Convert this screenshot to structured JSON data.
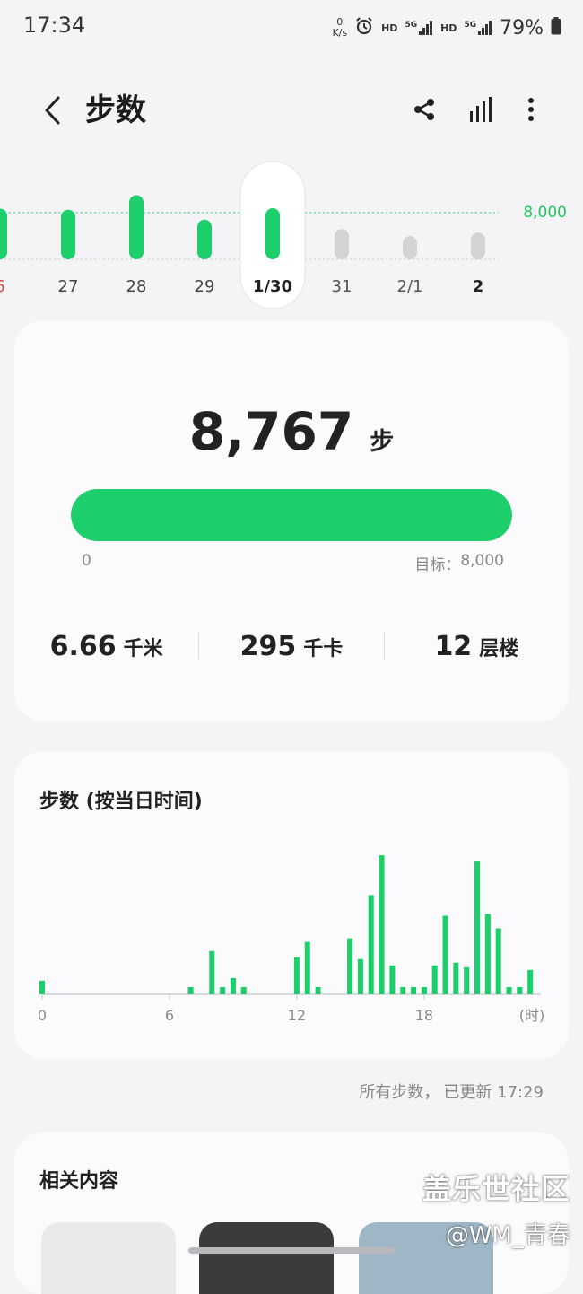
{
  "status_bar": {
    "time": "17:34",
    "net_speed_value": "0",
    "net_speed_unit": "K/s",
    "hd1": "HD",
    "sim1": "5G",
    "hd2": "HD",
    "sim2": "5G",
    "battery": "79%",
    "icons": [
      "alarm-icon",
      "signal-icon",
      "battery-icon"
    ]
  },
  "header": {
    "title": "步数",
    "icons": [
      "back-icon",
      "share-icon",
      "bar-chart-icon",
      "more-vert-icon"
    ]
  },
  "day_strip": {
    "goal_label": "8,000",
    "goal": 8000,
    "days": [
      {
        "label": "6",
        "steps": 8700,
        "color": "#1ccf6a",
        "label_color": "#e23b3b",
        "selected": false,
        "bold": false
      },
      {
        "label": "27",
        "steps": 8500,
        "color": "#1ccf6a",
        "label_color": "#444444",
        "selected": false,
        "bold": false
      },
      {
        "label": "28",
        "steps": 11000,
        "color": "#1ccf6a",
        "label_color": "#444444",
        "selected": false,
        "bold": false
      },
      {
        "label": "29",
        "steps": 6800,
        "color": "#1ccf6a",
        "label_color": "#444444",
        "selected": false,
        "bold": false
      },
      {
        "label": "1/30",
        "steps": 8767,
        "color": "#1ccf6a",
        "label_color": "#222222",
        "selected": true,
        "bold": true
      },
      {
        "label": "31",
        "steps": 5200,
        "color": "#d3d3d6",
        "label_color": "#555555",
        "selected": false,
        "bold": false
      },
      {
        "label": "2/1",
        "steps": 4000,
        "color": "#d3d3d6",
        "label_color": "#555555",
        "selected": false,
        "bold": false
      },
      {
        "label": "2",
        "steps": 4600,
        "color": "#d3d3d6",
        "label_color": "#222222",
        "selected": false,
        "bold": true
      }
    ]
  },
  "summary": {
    "steps": "8,767",
    "steps_unit": "步",
    "progress": 1.0,
    "progress_min": "0",
    "goal_prefix": "目标：",
    "goal_value": "8,000",
    "distance": "6.66",
    "distance_unit": "千米",
    "calories": "295",
    "calories_unit": "千卡",
    "floors": "12",
    "floors_unit": "层楼"
  },
  "hourly": {
    "title": "步数 (按当日时间)",
    "unit_label": "(时)"
  },
  "chart_data": {
    "type": "bar",
    "title": "步数 (按当日时间)",
    "xlabel": "(时)",
    "ylabel": "",
    "x_ticks": [
      "0",
      "6",
      "12",
      "18"
    ],
    "xlim": [
      0,
      23.5
    ],
    "ylim": [
      0,
      1700
    ],
    "bars": [
      {
        "x": 0,
        "y": 150
      },
      {
        "x": 7,
        "y": 80
      },
      {
        "x": 8,
        "y": 480
      },
      {
        "x": 8.5,
        "y": 80
      },
      {
        "x": 9,
        "y": 180
      },
      {
        "x": 9.5,
        "y": 80
      },
      {
        "x": 12,
        "y": 410
      },
      {
        "x": 12.5,
        "y": 580
      },
      {
        "x": 13,
        "y": 80
      },
      {
        "x": 14.5,
        "y": 620
      },
      {
        "x": 15,
        "y": 390
      },
      {
        "x": 15.5,
        "y": 1100
      },
      {
        "x": 16,
        "y": 1540
      },
      {
        "x": 16.5,
        "y": 320
      },
      {
        "x": 17,
        "y": 80
      },
      {
        "x": 17.5,
        "y": 80
      },
      {
        "x": 18,
        "y": 80
      },
      {
        "x": 18.5,
        "y": 320
      },
      {
        "x": 19,
        "y": 870
      },
      {
        "x": 19.5,
        "y": 350
      },
      {
        "x": 20,
        "y": 300
      },
      {
        "x": 20.5,
        "y": 1470
      },
      {
        "x": 21,
        "y": 890
      },
      {
        "x": 21.5,
        "y": 730
      },
      {
        "x": 22,
        "y": 80
      },
      {
        "x": 22.5,
        "y": 80
      },
      {
        "x": 23,
        "y": 270
      }
    ]
  },
  "updated": {
    "prefix": "所有步数，",
    "text": "已更新 17:29"
  },
  "related": {
    "title": "相关内容"
  },
  "watermark": {
    "line1": "盖乐世社区",
    "line2": "@WM_青春"
  },
  "colors": {
    "accent": "#1ccf6a",
    "inactive_bar": "#d3d3d6",
    "background": "#f4f4f7",
    "card": "#fbfbfd"
  }
}
